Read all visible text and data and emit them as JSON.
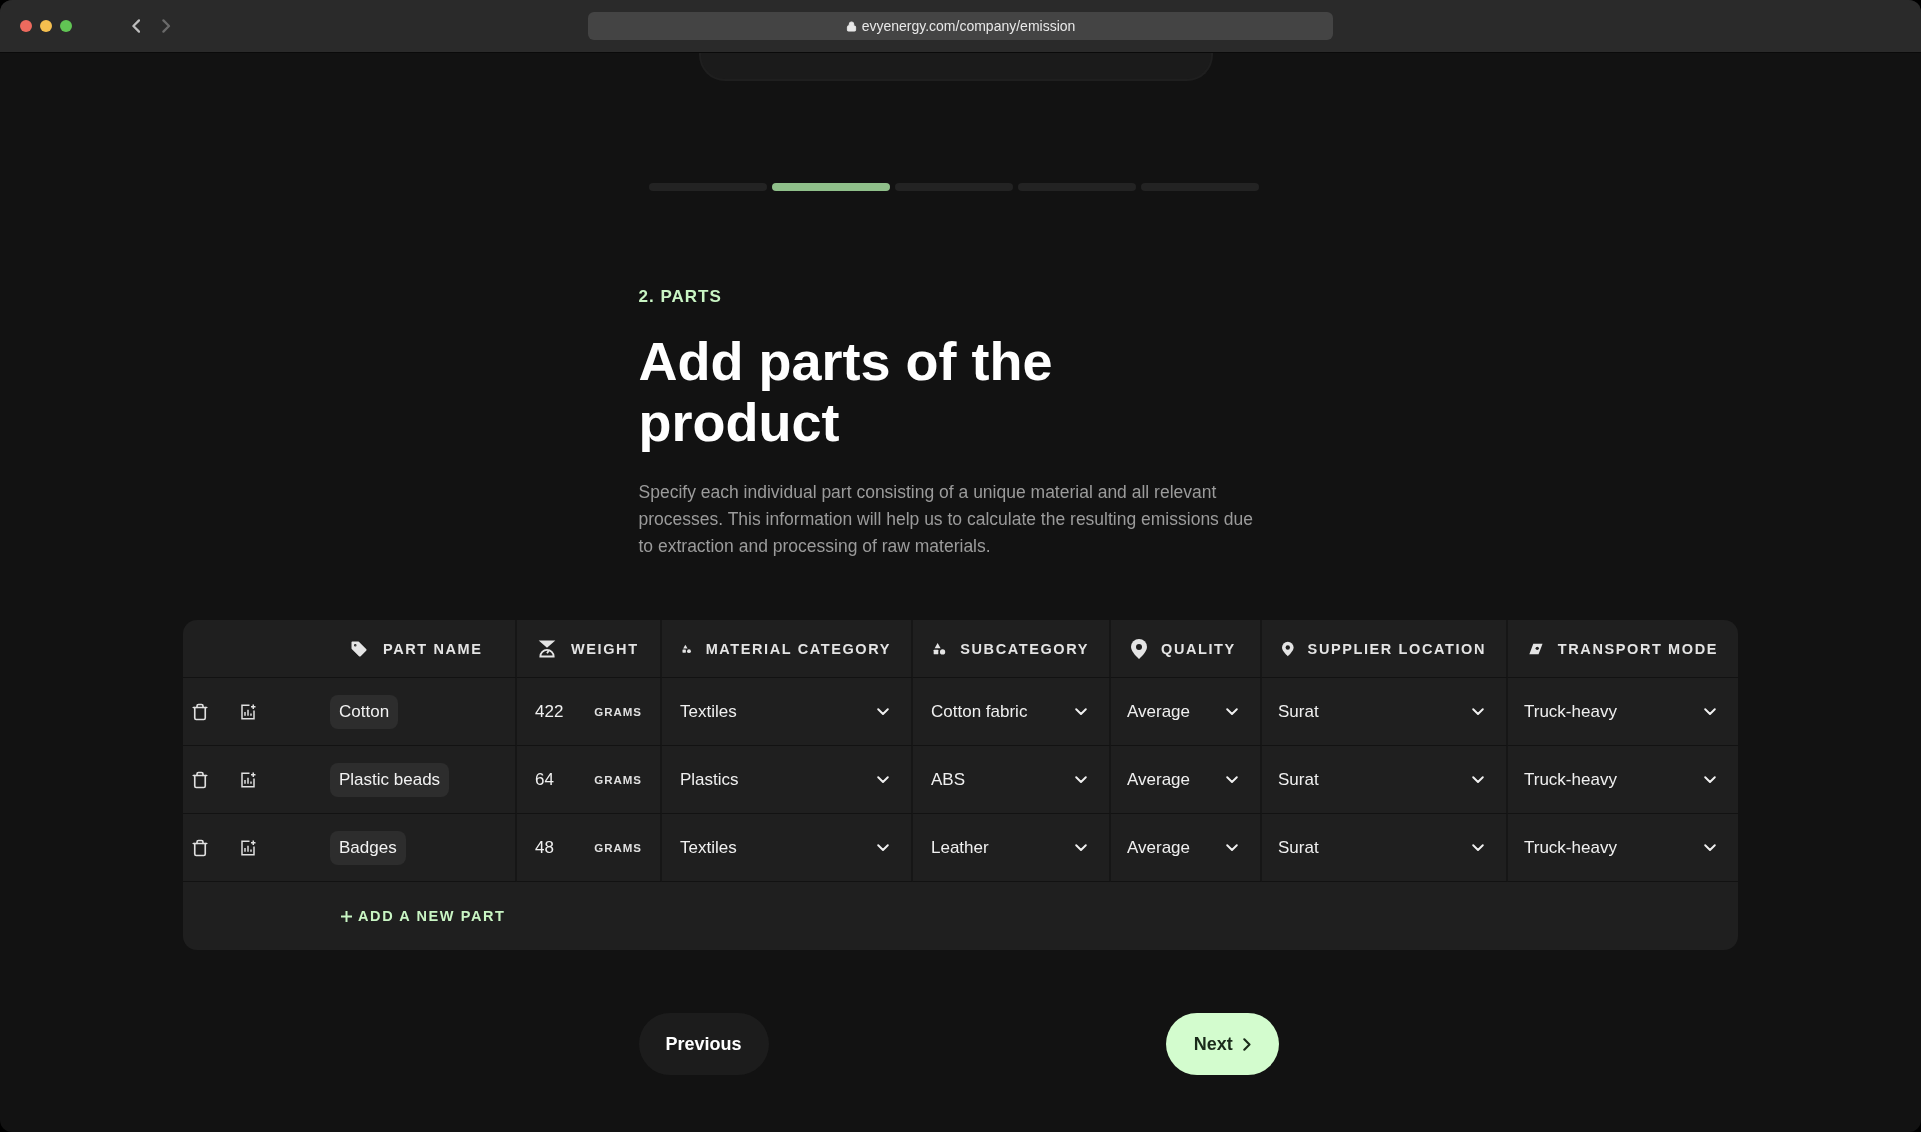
{
  "browser": {
    "url": "evyenergy.com/company/emission"
  },
  "progress": [
    {
      "selected": false
    },
    {
      "selected": true
    },
    {
      "selected": false
    },
    {
      "selected": false
    },
    {
      "selected": false
    }
  ],
  "step_label": "2. PARTS",
  "title": "Add parts of the product",
  "description": "Specify each individual part consisting of a unique material and all relevant processes. This information will help us to calculate the resulting emissions due to extraction and processing of raw materials.",
  "table": {
    "columns": [
      "PART NAME",
      "WEIGHT",
      "MATERIAL CATEGORY",
      "SUBCATEGORY",
      "QUALITY",
      "SUPPLIER LOCATION",
      "TRANSPORT MODE"
    ],
    "rows": [
      {
        "name": "Cotton",
        "weight": "422",
        "unit": "GRAMS",
        "material_category": "Textiles",
        "subcategory": "Cotton fabric",
        "quality": "Average",
        "supplier_location": "Surat",
        "transport_mode": "Truck-heavy"
      },
      {
        "name": "Plastic beads",
        "weight": "64",
        "unit": "GRAMS",
        "material_category": "Plastics",
        "subcategory": "ABS",
        "quality": "Average",
        "supplier_location": "Surat",
        "transport_mode": "Truck-heavy"
      },
      {
        "name": "Badges",
        "weight": "48",
        "unit": "GRAMS",
        "material_category": "Textiles",
        "subcategory": "Leather",
        "quality": "Average",
        "supplier_location": "Surat",
        "transport_mode": "Truck-heavy"
      }
    ],
    "add_label": "ADD A NEW PART"
  },
  "buttons": {
    "previous": "Previous",
    "next": "Next"
  }
}
